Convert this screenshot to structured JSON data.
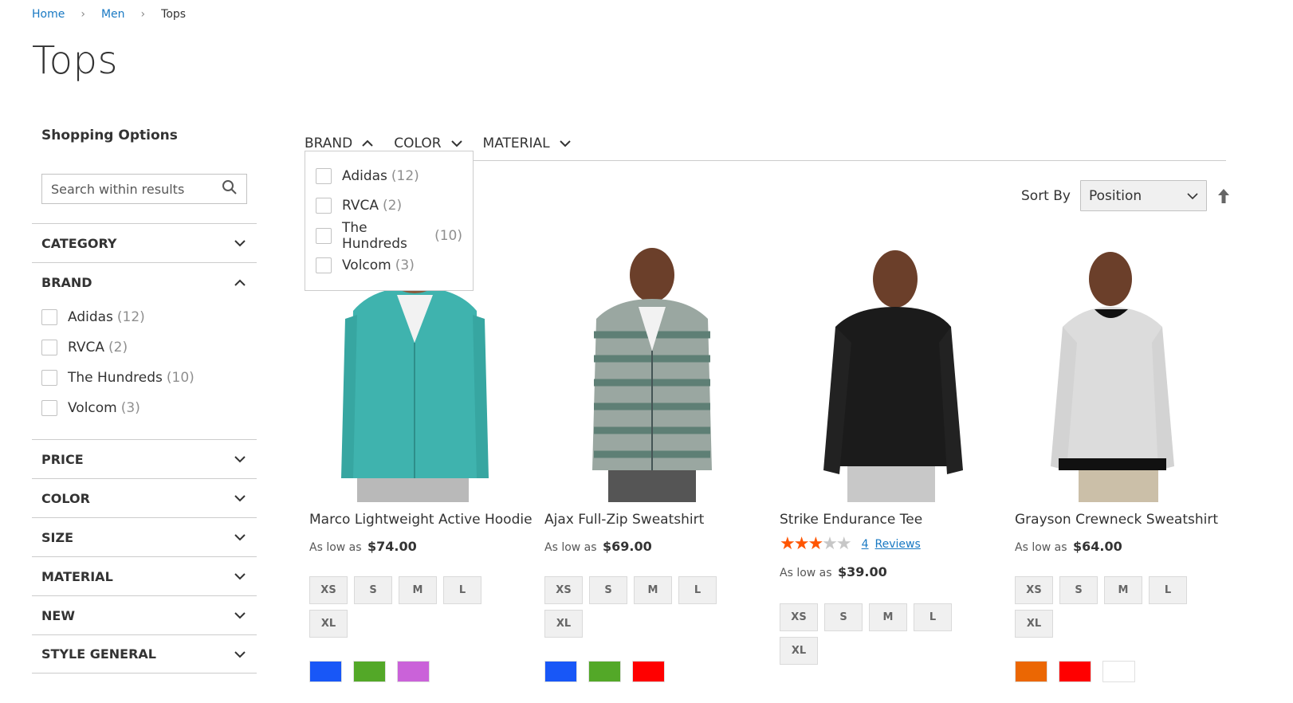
{
  "breadcrumb": {
    "home": "Home",
    "men": "Men",
    "current": "Tops",
    "separator": "›"
  },
  "page": {
    "title": "Tops"
  },
  "sidebar": {
    "title": "Shopping Options",
    "search_placeholder": "Search within results",
    "category": "CATEGORY",
    "brand": "BRAND",
    "brand_options": [
      {
        "name": "Adidas",
        "count": "(12)"
      },
      {
        "name": "RVCA",
        "count": "(2)"
      },
      {
        "name": "The Hundreds",
        "count": "(10)"
      },
      {
        "name": "Volcom",
        "count": "(3)"
      }
    ],
    "price": "PRICE",
    "color": "COLOR",
    "size": "SIZE",
    "material": "MATERIAL",
    "new": "NEW",
    "style_general": "STYLE GENERAL"
  },
  "topbar": {
    "brand": "BRAND",
    "color": "COLOR",
    "material": "MATERIAL",
    "dropdown": [
      {
        "name": "Adidas",
        "count": "(12)"
      },
      {
        "name": "RVCA",
        "count": "(2)"
      },
      {
        "name": "The Hundreds",
        "count": "(10)"
      },
      {
        "name": "Volcom",
        "count": "(3)"
      }
    ]
  },
  "sorter": {
    "label": "Sort By",
    "value": "Position"
  },
  "products": [
    {
      "name": "Marco Lightweight Active Hoodie",
      "price_prefix": "As low as",
      "price": "$74.00",
      "sizes": [
        "XS",
        "S",
        "M",
        "L",
        "XL"
      ],
      "swatches": [
        "#1857f7",
        "#53a828",
        "#ca62d9"
      ]
    },
    {
      "name": "Ajax Full-Zip Sweatshirt",
      "price_prefix": "As low as",
      "price": "$69.00",
      "sizes": [
        "XS",
        "S",
        "M",
        "L",
        "XL"
      ],
      "swatches": [
        "#1857f7",
        "#53a828",
        "#ff0000"
      ]
    },
    {
      "name": "Strike Endurance Tee",
      "rating": 3,
      "rating_max": 5,
      "review_count": "4",
      "review_label": "Reviews",
      "price_prefix": "As low as",
      "price": "$39.00",
      "sizes": [
        "XS",
        "S",
        "M",
        "L",
        "XL"
      ],
      "swatches": []
    },
    {
      "name": "Grayson Crewneck Sweatshirt",
      "price_prefix": "As low as",
      "price": "$64.00",
      "sizes": [
        "XS",
        "S",
        "M",
        "L",
        "XL"
      ],
      "swatches": [
        "#eb6703",
        "#ff0000",
        "#ffffff"
      ]
    }
  ],
  "icons": {
    "search": "search-icon",
    "chevron_down": "chevron-down-icon",
    "chevron_up": "chevron-up-icon",
    "sort_direction": "arrow-up-icon"
  }
}
